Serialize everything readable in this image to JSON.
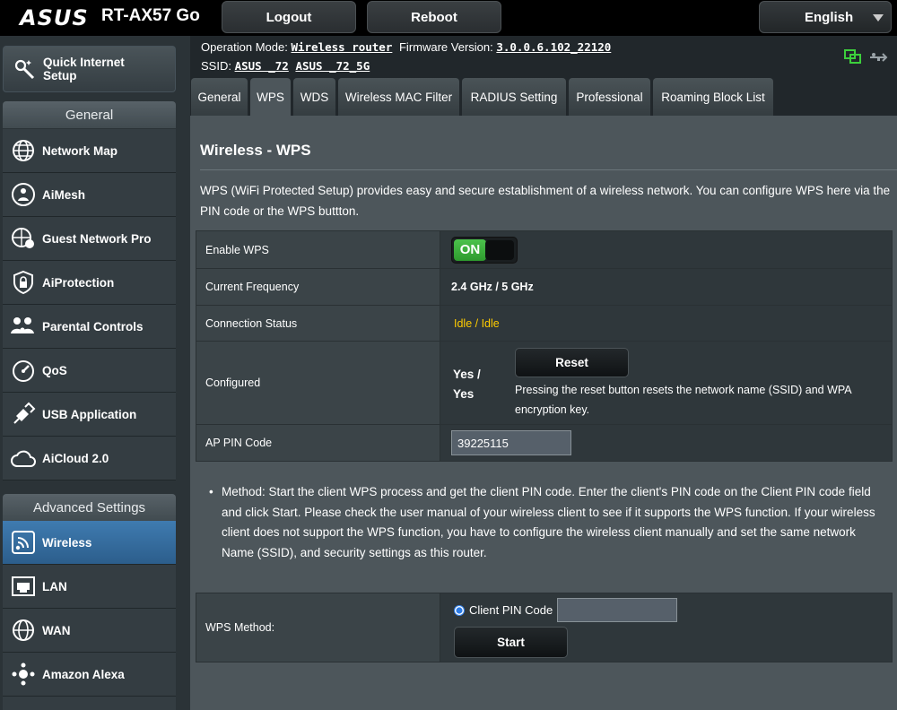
{
  "header": {
    "brand": "ASUS",
    "model": "RT-AX57 Go",
    "logout_label": "Logout",
    "reboot_label": "Reboot",
    "language": "English"
  },
  "info": {
    "operation_mode_label": "Operation Mode:",
    "operation_mode_value": "Wireless router",
    "firmware_label": "Firmware Version:",
    "firmware_value": "3.0.0.6.102_22120",
    "ssid_label": "SSID:",
    "ssid_1": "ASUS _72",
    "ssid_2": "ASUS _72_5G"
  },
  "sidebar": {
    "quick_setup": "Quick Internet Setup",
    "general_heading": "General",
    "general_items": [
      {
        "label": "Network Map",
        "icon": "globe-icon"
      },
      {
        "label": "AiMesh",
        "icon": "aimesh-icon"
      },
      {
        "label": "Guest Network Pro",
        "icon": "guest-network-icon"
      },
      {
        "label": "AiProtection",
        "icon": "shield-lock-icon"
      },
      {
        "label": "Parental Controls",
        "icon": "family-icon"
      },
      {
        "label": "QoS",
        "icon": "speedometer-icon"
      },
      {
        "label": "USB Application",
        "icon": "usb-icon"
      },
      {
        "label": "AiCloud 2.0",
        "icon": "cloud-icon"
      }
    ],
    "advanced_heading": "Advanced Settings",
    "advanced_items": [
      {
        "label": "Wireless",
        "icon": "wifi-icon"
      },
      {
        "label": "LAN",
        "icon": "lan-icon"
      },
      {
        "label": "WAN",
        "icon": "wan-globe-icon"
      },
      {
        "label": "Amazon Alexa",
        "icon": "alexa-icon"
      }
    ]
  },
  "tabs": [
    "General",
    "WPS",
    "WDS",
    "Wireless MAC Filter",
    "RADIUS Setting",
    "Professional",
    "Roaming Block List"
  ],
  "page": {
    "title": "Wireless - WPS",
    "description": "WPS (WiFi Protected Setup) provides easy and secure establishment of a wireless network. You can configure WPS here via the PIN code or the WPS buttton.",
    "rows": {
      "enable_wps_label": "Enable WPS",
      "enable_wps_state": "ON",
      "frequency_label": "Current Frequency",
      "frequency_value": "2.4 GHz / 5 GHz",
      "status_label": "Connection Status",
      "status_value": "Idle / Idle",
      "configured_label": "Configured",
      "configured_value_1": "Yes /",
      "configured_value_2": "Yes",
      "reset_label": "Reset",
      "reset_note": "Pressing the reset button resets the network name (SSID) and WPA encryption key.",
      "ap_pin_label": "AP PIN Code",
      "ap_pin_value": "39225115"
    },
    "method_note": "Method: Start the client WPS process and get the client PIN code. Enter the client's PIN code on the Client PIN code field and click Start. Please check the user manual of your wireless client to see if it supports the WPS function. If your wireless client does not support the WPS function, you have to configure the wireless client manually and set the same network Name (SSID), and security settings as this router.",
    "wps_method_label": "WPS Method:",
    "client_pin_label": "Client PIN Code",
    "client_pin_value": "",
    "start_label": "Start"
  },
  "colors": {
    "accent_blue": "#2c5e8c",
    "status_yellow": "#ffcc00",
    "toggle_green": "#3aae3a"
  }
}
